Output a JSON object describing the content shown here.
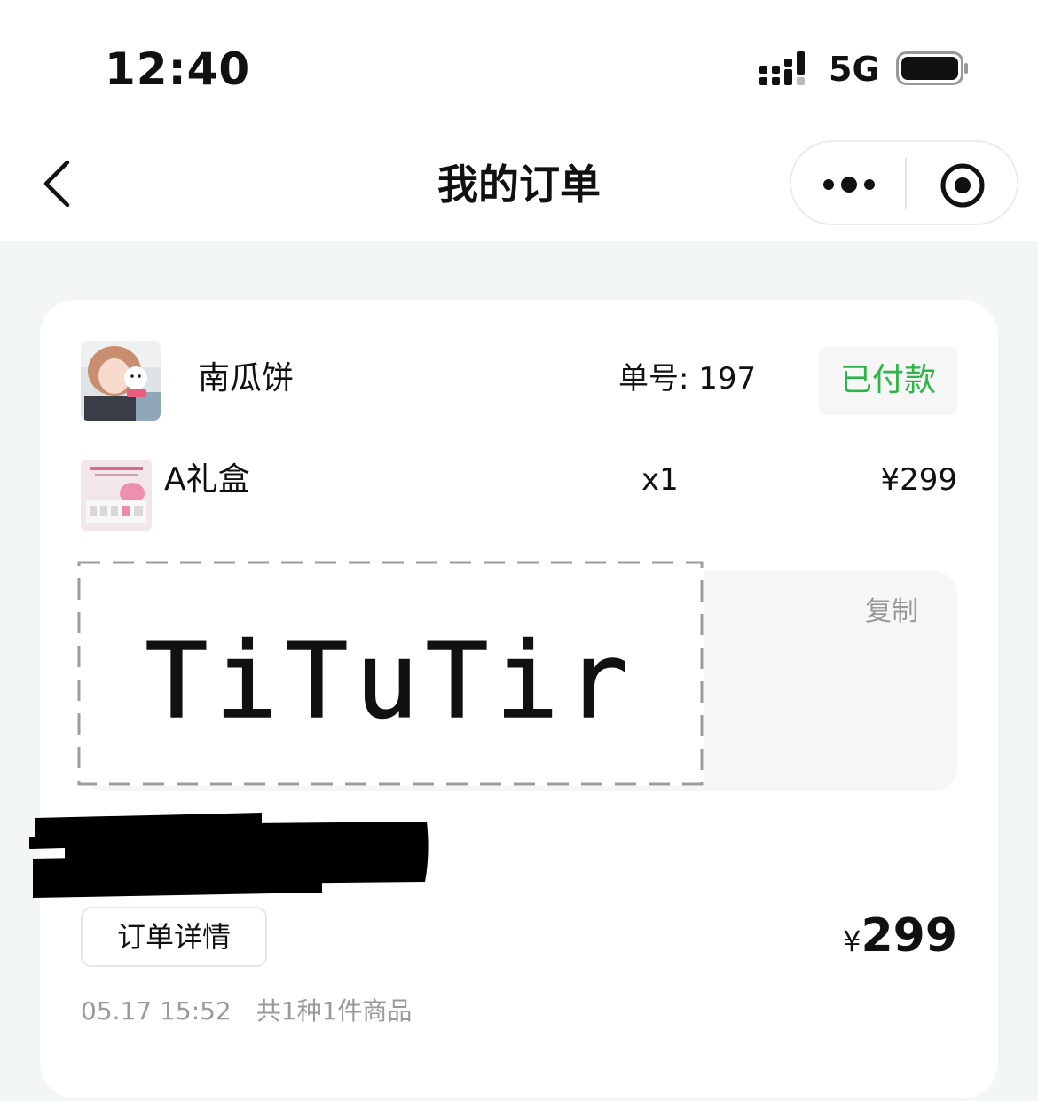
{
  "status_bar": {
    "time": "12:40",
    "network": "5G",
    "icons": [
      "signal-icon",
      "battery-icon"
    ]
  },
  "nav": {
    "title": "我的订单",
    "icons": [
      "back-icon",
      "more-icon",
      "target-icon"
    ]
  },
  "order": {
    "shop_name": "南瓜饼",
    "order_no": "单号: 197",
    "status": "已付款",
    "status_color": "#2fb44b",
    "item": {
      "name": "A礼盒",
      "quantity": "x1",
      "price": "¥299"
    },
    "note": {
      "copy_label": "复制",
      "signature": "TiTuTir"
    },
    "detail_button": "订单详情",
    "total_currency": "¥",
    "total_amount": "299",
    "time": "05.17 15:52",
    "summary": "共1种1件商品"
  }
}
